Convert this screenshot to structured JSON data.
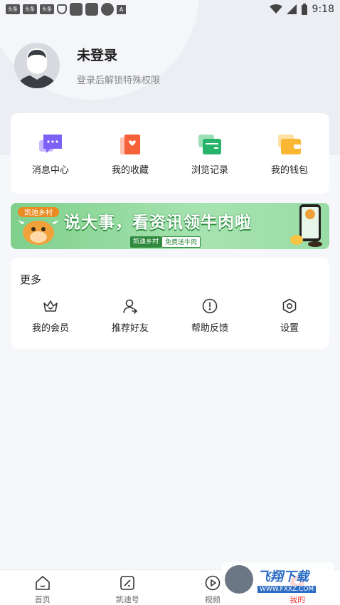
{
  "status_bar": {
    "app_badge_1": "头条",
    "app_badge_2": "头条",
    "app_badge_3": "头条",
    "a_badge": "A",
    "time": "9:18"
  },
  "profile": {
    "name": "未登录",
    "subtitle": "登录后解锁特殊权限"
  },
  "quick_menu": [
    {
      "label": "消息中心",
      "icon": "message-icon"
    },
    {
      "label": "我的收藏",
      "icon": "favorite-icon"
    },
    {
      "label": "浏览记录",
      "icon": "history-icon"
    },
    {
      "label": "我的钱包",
      "icon": "wallet-icon"
    }
  ],
  "banner": {
    "logo_text": "凯迪乡村",
    "title": "说大事，看资讯领牛肉啦",
    "tag_left": "凯迪乡村",
    "tag_right": "免费送牛肉"
  },
  "more_section": {
    "title": "更多",
    "items": [
      {
        "label": "我的会员",
        "icon": "crown-icon"
      },
      {
        "label": "推荐好友",
        "icon": "user-plus-icon"
      },
      {
        "label": "帮助反馈",
        "icon": "info-icon"
      },
      {
        "label": "设置",
        "icon": "settings-icon"
      }
    ]
  },
  "tabbar": [
    {
      "label": "首页",
      "icon": "home-icon",
      "active": false
    },
    {
      "label": "凯迪号",
      "icon": "kaidi-icon",
      "active": false
    },
    {
      "label": "视频",
      "icon": "video-icon",
      "active": false
    },
    {
      "label": "我的",
      "icon": "profile-icon",
      "active": true
    }
  ],
  "watermark": {
    "cn": "飞翔下载",
    "en": "WWW.FXXZ.COM"
  },
  "colors": {
    "accent_red": "#e53935",
    "banner_green": "#7fd08c",
    "page_bg": "#f6f7fb"
  }
}
